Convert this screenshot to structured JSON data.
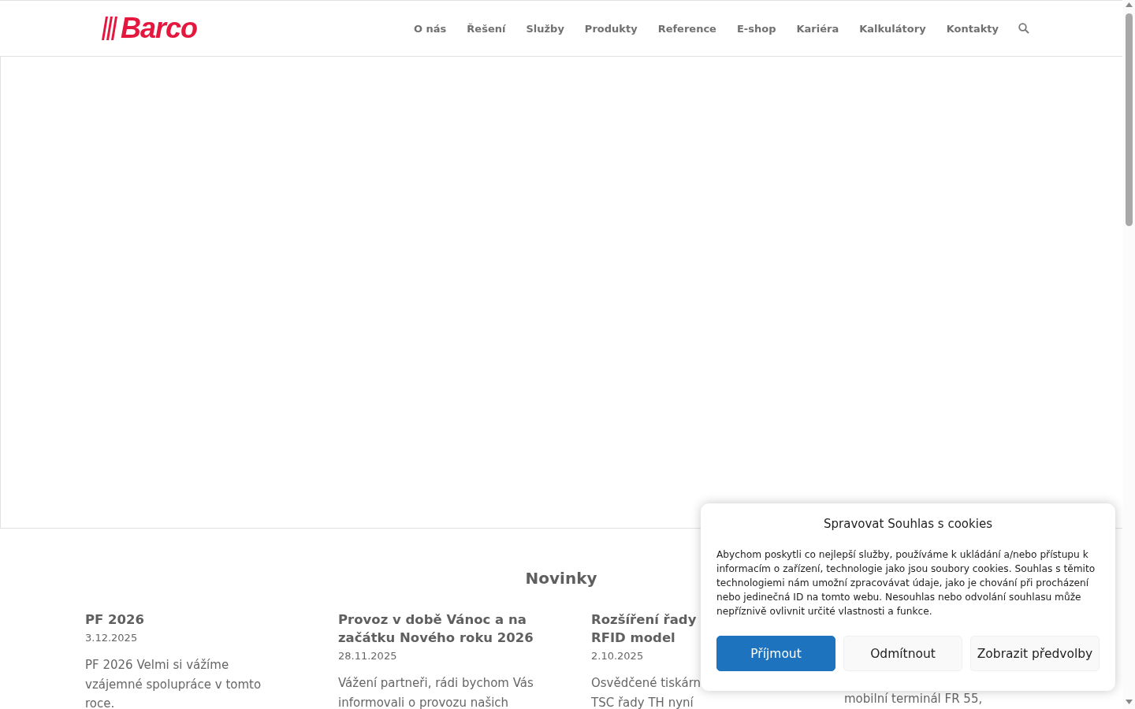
{
  "header": {
    "logo": "Barco",
    "nav": [
      {
        "label": "O nás"
      },
      {
        "label": "Řešení"
      },
      {
        "label": "Služby"
      },
      {
        "label": "Produkty"
      },
      {
        "label": "Reference"
      },
      {
        "label": "E-shop"
      },
      {
        "label": "Kariéra"
      },
      {
        "label": "Kalkulátory"
      },
      {
        "label": "Kontakty"
      }
    ]
  },
  "news": {
    "heading": "Novinky",
    "cards": [
      {
        "title": "PF 2026",
        "date": "3.12.2025",
        "body_lines": [
          "PF 2026 Velmi si vážíme",
          "vzájemné spolupráce v tomto",
          "roce."
        ]
      },
      {
        "title": "Provoz v době Vánoc a na začátku Nového roku 2026",
        "date": "28.11.2025",
        "body_lines": [
          "Vážení partneři, rádi bychom Vás",
          "informovali o provozu našich"
        ]
      },
      {
        "title": "Rozšíření řady",
        "title_line2": "RFID model",
        "date": "2.10.2025",
        "body_lines": [
          "Osvědčené tiskárn",
          "TSC řady TH nyní"
        ]
      },
      {
        "body_lines": [
          "mobilní terminál FR 55,"
        ]
      }
    ]
  },
  "cookie_dialog": {
    "title": "Spravovat Souhlas s cookies",
    "text": "Abychom poskytli co nejlepší služby, používáme k ukládání a/nebo přístupu k informacím o zařízení, technologie jako jsou soubory cookies. Souhlas s těmito technologiemi nám umožní zpracovávat údaje, jako je chování při procházení nebo jedinečná ID na tomto webu. Nesouhlas nebo odvolání souhlasu může nepříznivě ovlivnit určité vlastnosti a funkce.",
    "buttons": [
      {
        "label": "Příjmout",
        "kind": "primary"
      },
      {
        "label": "Odmítnout",
        "kind": "secondary"
      },
      {
        "label": "Zobrazit předvolby",
        "kind": "secondary"
      }
    ]
  }
}
